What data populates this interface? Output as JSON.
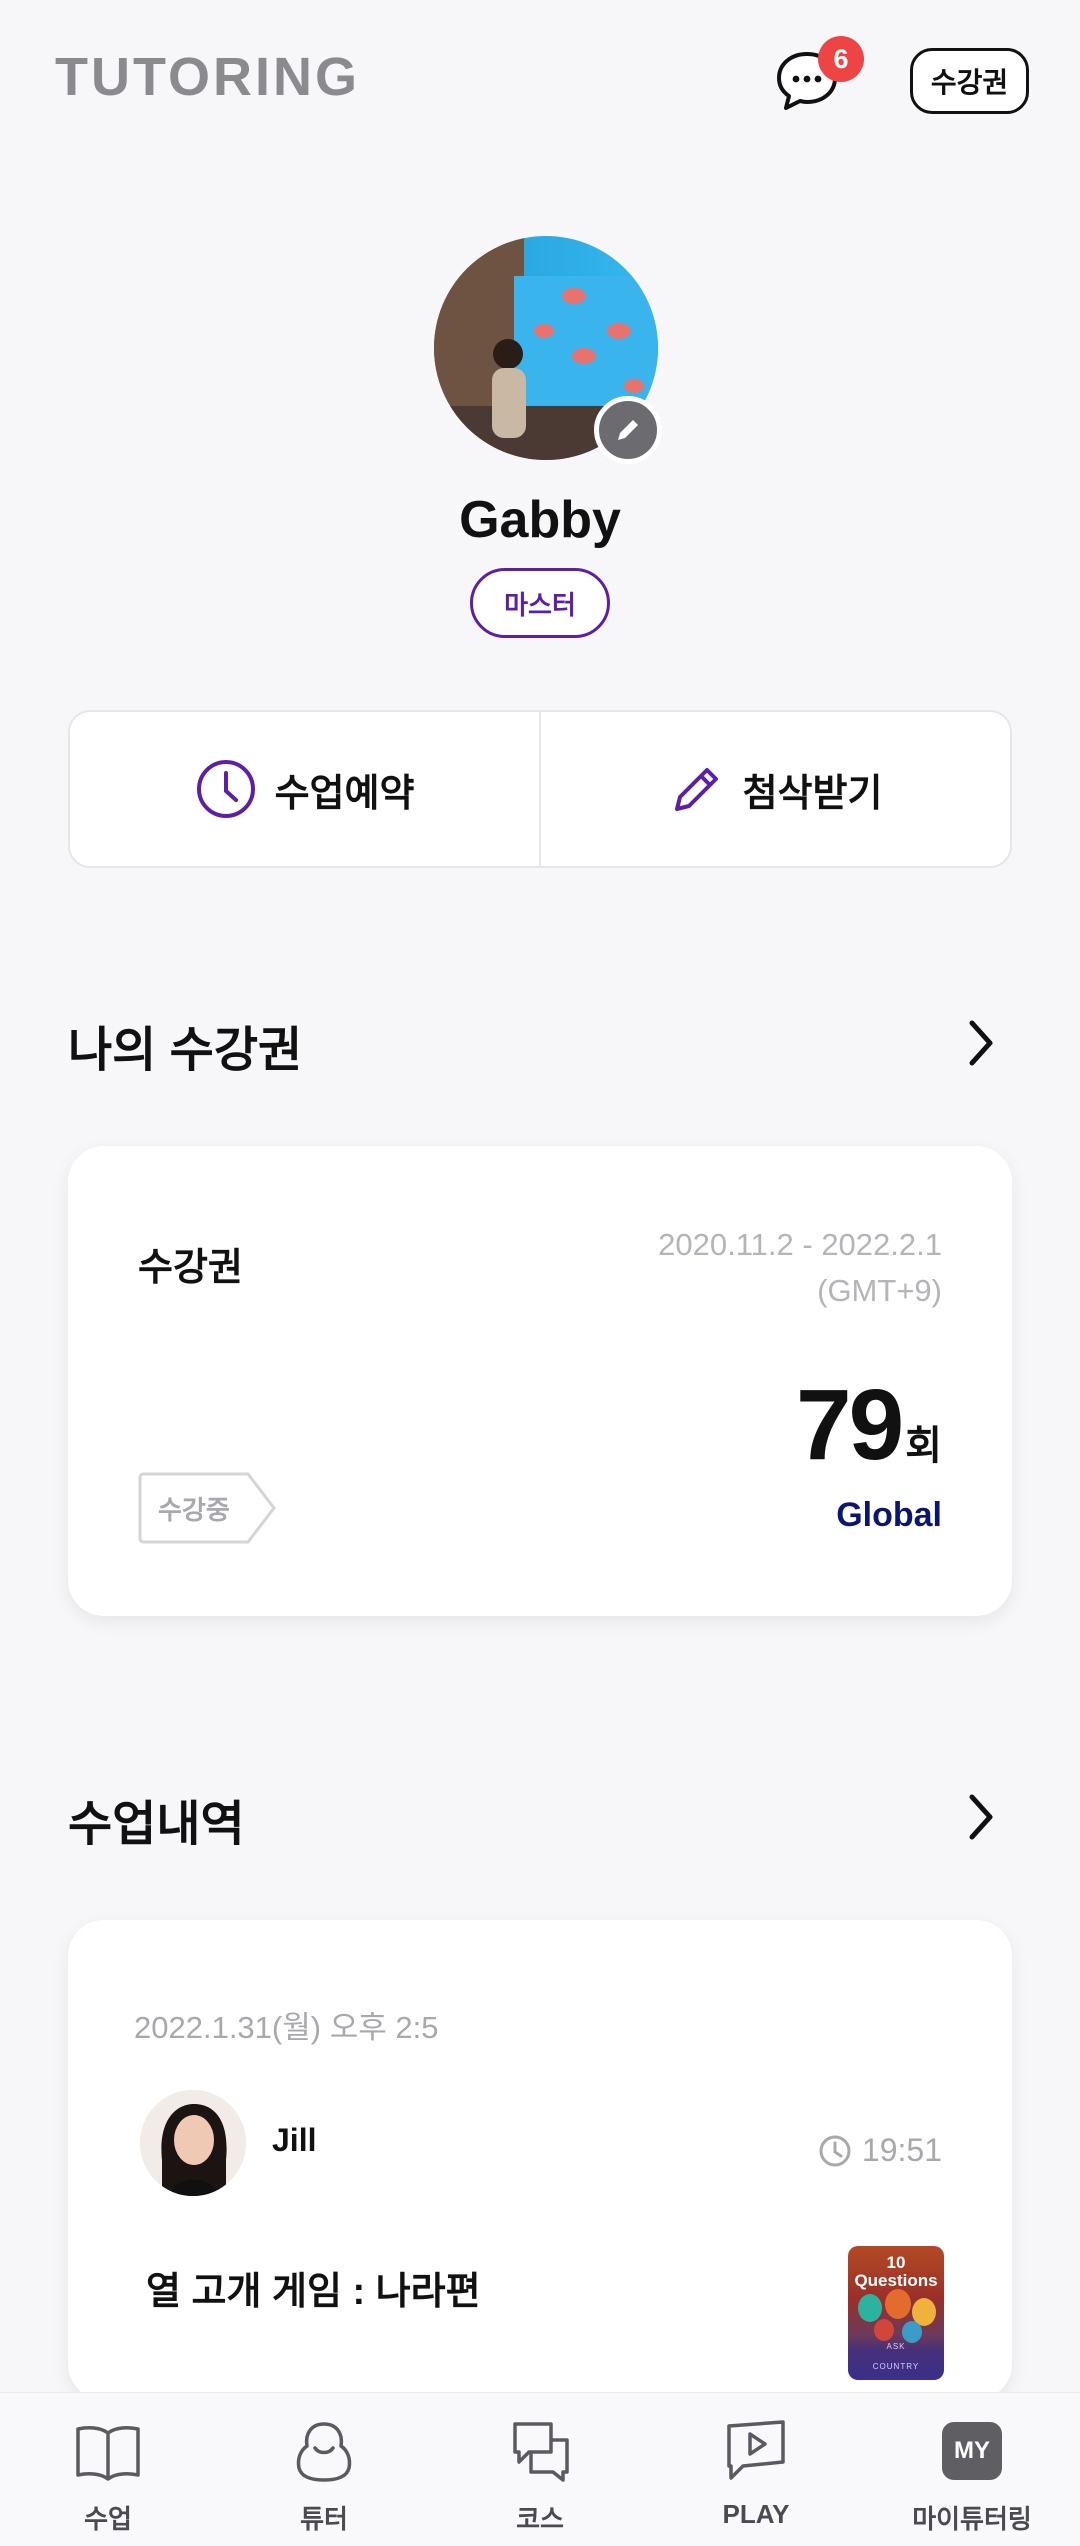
{
  "header": {
    "logo_text": "TUTORING",
    "chat_badge_count": "6",
    "pass_button_label": "수강권"
  },
  "profile": {
    "name": "Gabby",
    "level": "마스터"
  },
  "actions": {
    "reserve_label": "수업예약",
    "correction_label": "첨삭받기"
  },
  "my_pass": {
    "section_title": "나의 수강권",
    "card": {
      "name": "수강권",
      "period": "2020.11.2 - 2022.2.1",
      "timezone": "(GMT+9)",
      "count": "79",
      "count_unit": "회",
      "status": "수강중",
      "type": "Global"
    }
  },
  "history": {
    "section_title": "수업내역",
    "card": {
      "date": "2022.1.31(월) 오후 2:5",
      "tutor_name": "Jill",
      "duration": "19:51",
      "lesson_title": "열 고개 게임 : 나라편",
      "thumb_title_1": "10",
      "thumb_title_2": "Questions",
      "thumb_sub_1": "ASK",
      "thumb_sub_2": "COUNTRY"
    }
  },
  "bottom_nav": {
    "items": [
      {
        "label": "수업",
        "icon": "book-icon"
      },
      {
        "label": "튜터",
        "icon": "tutor-icon"
      },
      {
        "label": "코스",
        "icon": "course-icon"
      },
      {
        "label": "PLAY",
        "icon": "play-icon"
      },
      {
        "label": "마이튜터링",
        "icon": "my-icon",
        "icon_text": "MY"
      }
    ]
  },
  "colors": {
    "background": "#f7f7fa",
    "brand_purple": "#5b1fa8",
    "badge_red": "#ee4444",
    "global_navy": "#0c1670"
  }
}
